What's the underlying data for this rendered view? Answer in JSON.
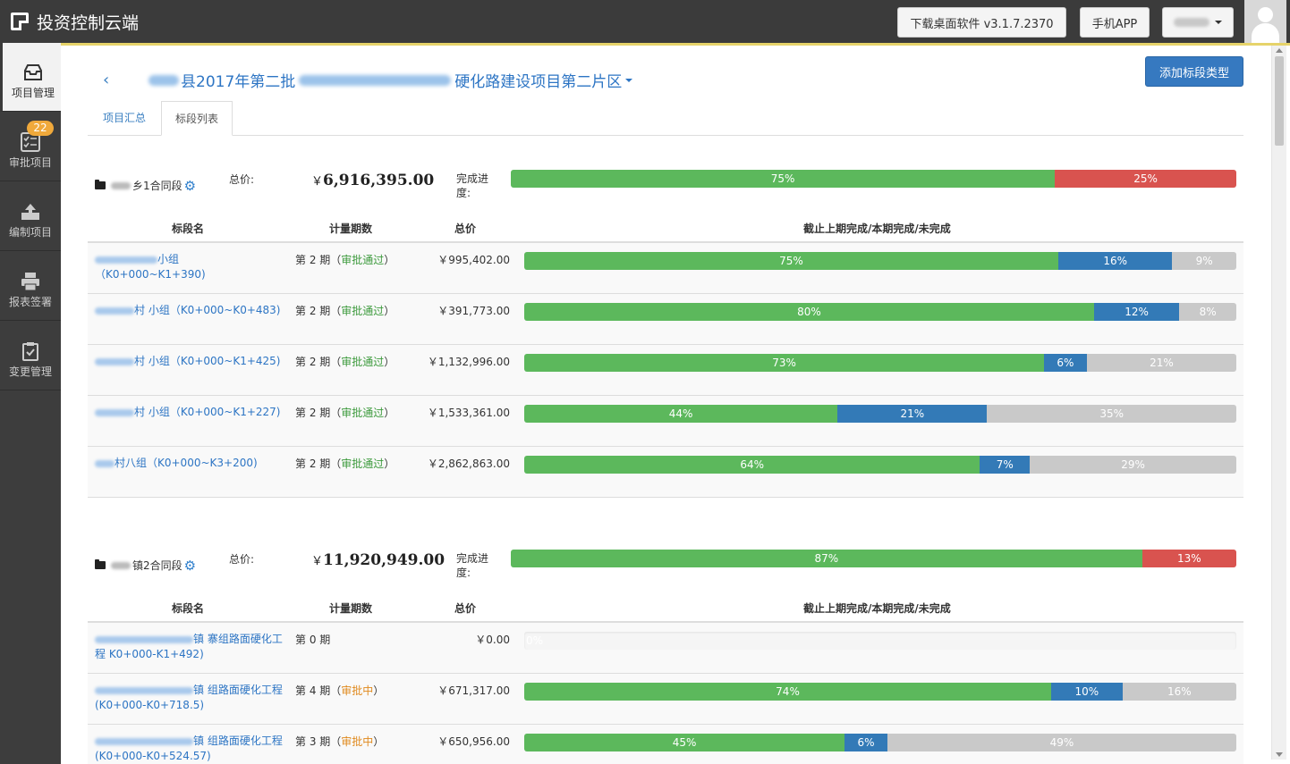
{
  "app": {
    "title": "投资控制云端"
  },
  "topbar": {
    "download_label": "下载桌面软件 v3.1.7.2370",
    "mobile_label": "手机APP"
  },
  "sidebar": {
    "items": [
      {
        "label": "项目管理",
        "icon": "inbox-icon",
        "active": true
      },
      {
        "label": "审批项目",
        "icon": "checklist-icon",
        "badge": "22"
      },
      {
        "label": "编制项目",
        "icon": "upload-icon"
      },
      {
        "label": "报表签署",
        "icon": "printer-icon"
      },
      {
        "label": "变更管理",
        "icon": "clipboard-icon"
      }
    ]
  },
  "header": {
    "title_prefix": "县2017年第二批",
    "title_suffix": "硬化路建设项目第二片区",
    "add_button": "添加标段类型"
  },
  "tabs": [
    {
      "label": "项目汇总",
      "active": false
    },
    {
      "label": "标段列表",
      "active": true
    }
  ],
  "labels": {
    "total": "总价:",
    "progress": "完成进度:",
    "col_name": "标段名",
    "col_period": "计量期数",
    "col_price": "总价",
    "col_progress": "截止上期完成/本期完成/未完成"
  },
  "colors": {
    "done": "#5cb85c",
    "remaining": "#d9534f",
    "current": "#337ab7",
    "undone": "#c9c9c9",
    "accent": "#3679c0"
  },
  "groups": [
    {
      "name_suffix": "乡1合同段",
      "total_yen": "￥",
      "total": "6,916,395.00",
      "done_pct": "75%",
      "remaining_pct": "25%",
      "done": 75,
      "remaining": 25,
      "rows": [
        {
          "name": "小组（K0+000~K1+390)",
          "period": "第 2 期",
          "status": "审批通过",
          "price": "￥995,402.00",
          "prev": "75%",
          "cur": "16%",
          "left": "9%",
          "p": 75,
          "c": 16,
          "l": 9
        },
        {
          "name": "村  小组（K0+000~K0+483)",
          "period": "第 2 期",
          "status": "审批通过",
          "price": "￥391,773.00",
          "prev": "80%",
          "cur": "12%",
          "left": "8%",
          "p": 80,
          "c": 12,
          "l": 8
        },
        {
          "name": "村  小组（K0+000~K1+425)",
          "period": "第 2 期",
          "status": "审批通过",
          "price": "￥1,132,996.00",
          "prev": "73%",
          "cur": "6%",
          "left": "21%",
          "p": 73,
          "c": 6,
          "l": 21
        },
        {
          "name": "村  小组（K0+000~K1+227)",
          "period": "第 2 期",
          "status": "审批通过",
          "price": "￥1,533,361.00",
          "prev": "44%",
          "cur": "21%",
          "left": "35%",
          "p": 44,
          "c": 21,
          "l": 35
        },
        {
          "name": "村八组（K0+000~K3+200)",
          "period": "第 2 期",
          "status": "审批通过",
          "price": "￥2,862,863.00",
          "prev": "64%",
          "cur": "7%",
          "left": "29%",
          "p": 64,
          "c": 7,
          "l": 29
        }
      ]
    },
    {
      "name_suffix": "镇2合同段",
      "total_yen": "￥",
      "total": "11,920,949.00",
      "done_pct": "87%",
      "remaining_pct": "13%",
      "done": 87,
      "remaining": 13,
      "rows": [
        {
          "name": "镇  寨组路面硬化工程 K0+000-K1+492)",
          "period": "第 0 期",
          "status": "",
          "price": "￥0.00",
          "prev": "0%",
          "cur": "",
          "left": "",
          "p": 0,
          "c": 0,
          "l": 0
        },
        {
          "name": "镇  组路面硬化工程 (K0+000-K0+718.5)",
          "period": "第 4 期",
          "status": "审批中",
          "price": "￥671,317.00",
          "prev": "74%",
          "cur": "10%",
          "left": "16%",
          "p": 74,
          "c": 10,
          "l": 16
        },
        {
          "name": "镇  组路面硬化工程 (K0+000-K0+524.57)",
          "period": "第 3 期",
          "status": "审批中",
          "price": "￥650,956.00",
          "prev": "45%",
          "cur": "6%",
          "left": "49%",
          "p": 45,
          "c": 6,
          "l": 49
        }
      ]
    }
  ]
}
